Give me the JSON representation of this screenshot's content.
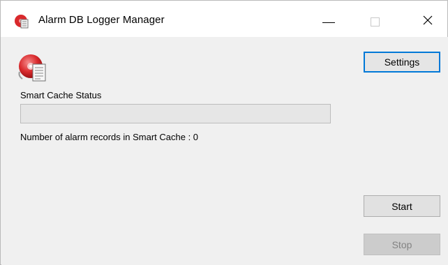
{
  "window": {
    "title": "Alarm DB Logger Manager",
    "icon": "alarm-db-icon"
  },
  "titlebar": {
    "minimize_icon": "minimize-icon",
    "maximize_icon": "maximize-icon",
    "close_icon": "close-icon"
  },
  "main": {
    "logo_icon": "disk-document-icon",
    "status_label": "Smart Cache Status",
    "progress_fraction": 0,
    "count_label": "Number of alarm records in Smart Cache :  0"
  },
  "buttons": {
    "settings": "Settings",
    "start": "Start",
    "stop": "Stop",
    "stop_enabled": false
  },
  "colors": {
    "focus_border": "#0078d7",
    "progress_fill": "#06b025",
    "icon_red": "#d9292c"
  }
}
